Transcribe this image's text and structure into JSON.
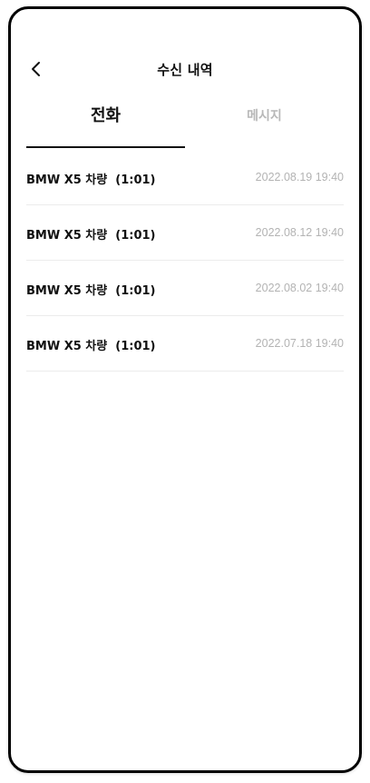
{
  "header": {
    "title": "수신 내역",
    "back_icon": "chevron-left-icon"
  },
  "tabs": [
    {
      "label": "전화",
      "active": true
    },
    {
      "label": "메시지",
      "active": false
    }
  ],
  "calls": [
    {
      "title": "BMW X5 차량  (1:01)",
      "date": "2022.08.19 19:40"
    },
    {
      "title": "BMW X5 차량  (1:01)",
      "date": "2022.08.12 19:40"
    },
    {
      "title": "BMW X5 차량  (1:01)",
      "date": "2022.08.02 19:40"
    },
    {
      "title": "BMW X5 차량  (1:01)",
      "date": "2022.07.18 19:40"
    }
  ]
}
